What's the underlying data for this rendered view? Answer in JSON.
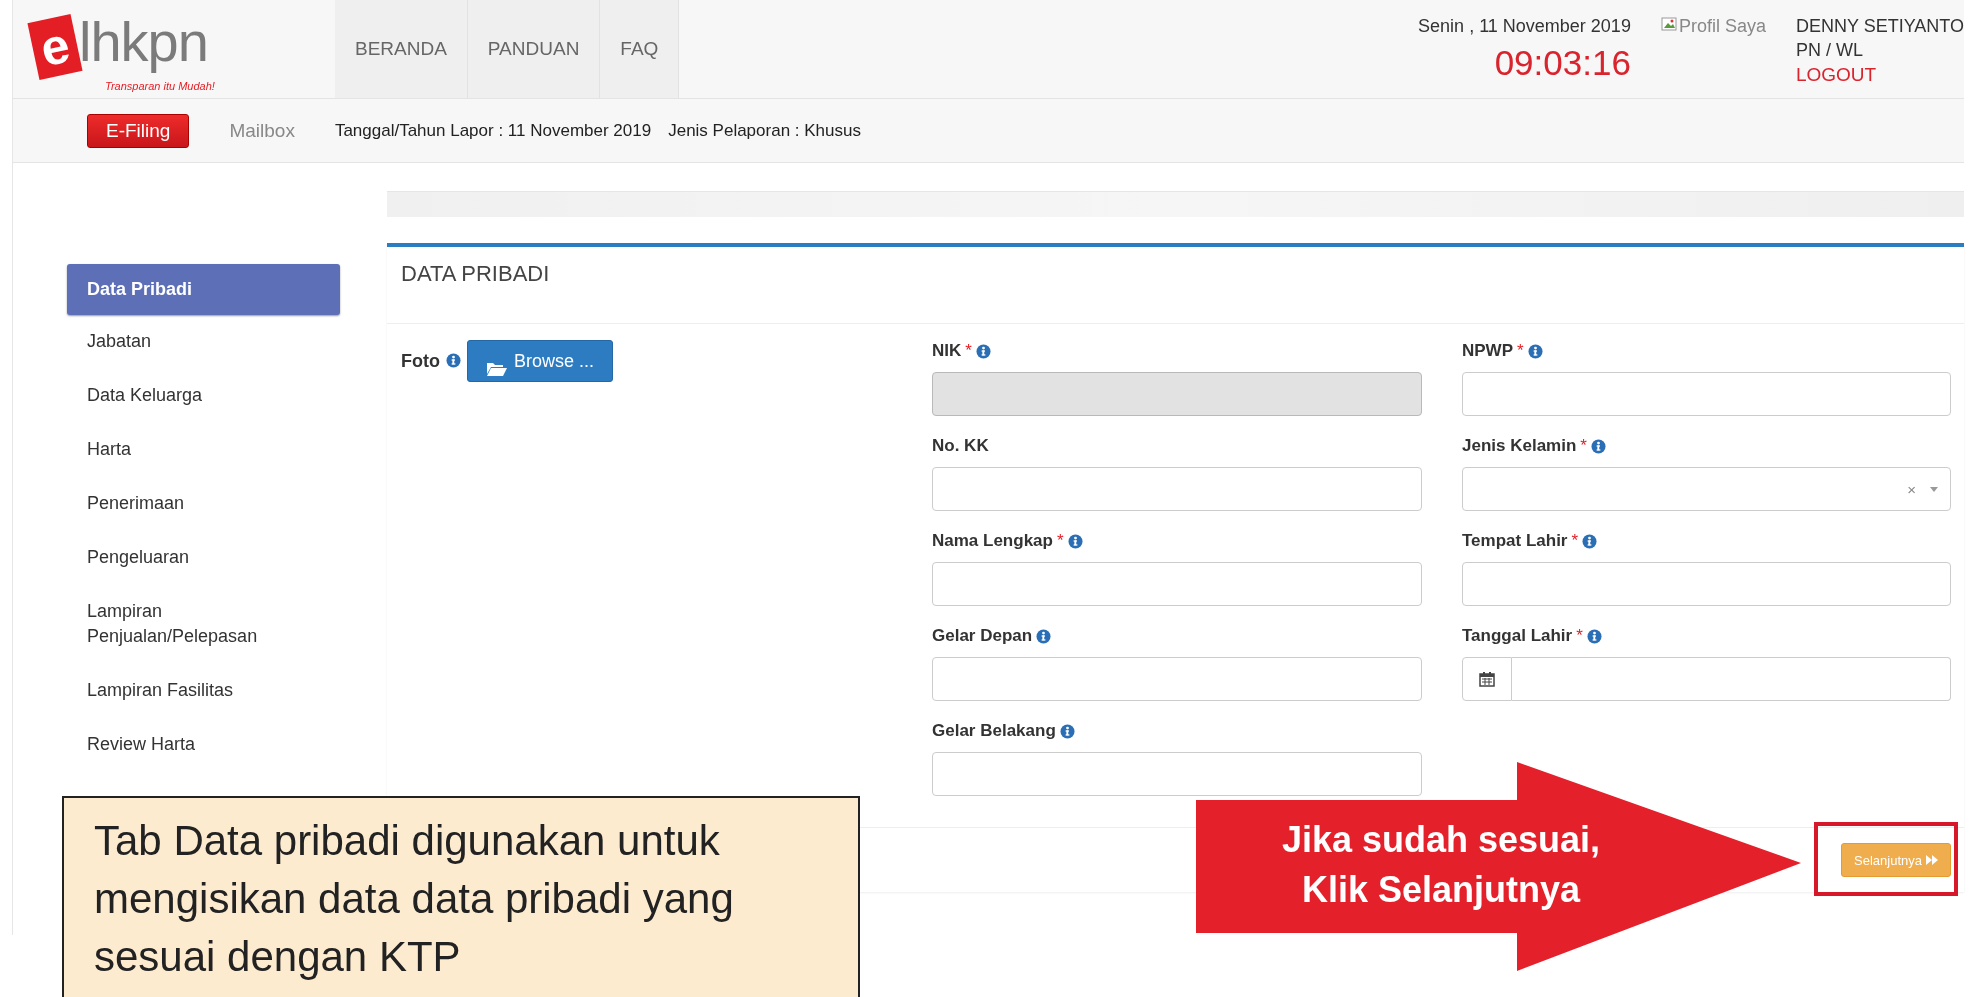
{
  "header": {
    "logo": {
      "mark": "e",
      "name": "lhkpn",
      "tagline": "Transparan itu Mudah!"
    },
    "nav": [
      {
        "label": "BERANDA"
      },
      {
        "label": "PANDUAN"
      },
      {
        "label": "FAQ"
      }
    ],
    "date": "Senin , 11 November 2019",
    "clock": "09:03:16",
    "profile_image_alt": "Profil Saya",
    "user_name": "DENNY SETIYANTO",
    "user_role": "PN / WL",
    "logout": "LOGOUT"
  },
  "subbar": {
    "tabs": [
      {
        "label": "E-Filing",
        "selected": true
      },
      {
        "label": "Mailbox",
        "selected": false
      }
    ],
    "report_date": "Tanggal/Tahun Lapor : 11 November 2019",
    "report_type": "Jenis Pelaporan : Khusus"
  },
  "sidebar": {
    "items": [
      {
        "label": "Data Pribadi",
        "selected": true
      },
      {
        "label": "Jabatan",
        "selected": false
      },
      {
        "label": "Data Keluarga",
        "selected": false
      },
      {
        "label": "Harta",
        "selected": false
      },
      {
        "label": "Penerimaan",
        "selected": false
      },
      {
        "label": "Pengeluaran",
        "selected": false
      },
      {
        "label": "Lampiran Penjualan/Pelepasan",
        "selected": false
      },
      {
        "label": "Lampiran Fasilitas",
        "selected": false
      },
      {
        "label": "Review Harta",
        "selected": false
      }
    ]
  },
  "panel": {
    "title": "DATA PRIBADI",
    "photo": {
      "label": "Foto",
      "info": true,
      "button": "Browse ..."
    },
    "fields": [
      {
        "label": "NIK",
        "required_mark": "*",
        "info": true,
        "kind": "text",
        "disabled": true
      },
      {
        "label": "NPWP",
        "required_mark": "*",
        "info": true,
        "kind": "text",
        "disabled": false
      },
      {
        "label": "No. KK",
        "info": false,
        "kind": "text",
        "disabled": false
      },
      {
        "label": "Jenis Kelamin",
        "required_mark": "*",
        "info": true,
        "kind": "select",
        "clear": "×",
        "disabled": false
      },
      {
        "label": "Nama Lengkap",
        "required_mark": "*",
        "info": true,
        "kind": "text",
        "disabled": false
      },
      {
        "label": "Tempat Lahir",
        "required_mark": "*",
        "info": true,
        "kind": "text",
        "disabled": false
      },
      {
        "label": "Gelar Depan",
        "info": true,
        "kind": "text",
        "disabled": false
      },
      {
        "label": "Tanggal Lahir",
        "required_mark": "*",
        "info": true,
        "kind": "date",
        "disabled": false
      },
      {
        "label": "Gelar Belakang",
        "info": true,
        "kind": "text",
        "disabled": false
      }
    ],
    "next_button": "Selanjutnya"
  },
  "annotations": {
    "note": "Tab Data pribadi digunakan untuk mengisikan data data pribadi yang sesuai dengan KTP",
    "arrow_text": [
      "Jika sudah sesuai,",
      "Klik Selanjutnya"
    ]
  }
}
